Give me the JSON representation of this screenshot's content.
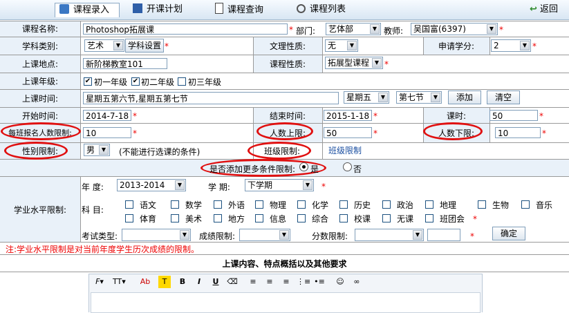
{
  "tabs": [
    {
      "label": "课程录入",
      "icon": "edit-icon",
      "active": true
    },
    {
      "label": "开课计划",
      "icon": "book-icon"
    },
    {
      "label": "课程查询",
      "icon": "document-icon"
    },
    {
      "label": "课程列表",
      "icon": "search-icon"
    }
  ],
  "back_label": "返回",
  "course_name": {
    "label": "课程名称:",
    "value": "Photoshop拓展课"
  },
  "dept": {
    "label": "部门:",
    "value": "艺体部"
  },
  "teacher": {
    "label": "教师:",
    "value": "吴国富(6397)"
  },
  "subject": {
    "label": "学科类别:",
    "value": "艺术",
    "button": "学科设置"
  },
  "science": {
    "label": "文理性质:",
    "value": "无"
  },
  "credits": {
    "label": "申请学分:",
    "value": "2"
  },
  "location": {
    "label": "上课地点:",
    "value": "新阶梯教室101"
  },
  "course_type": {
    "label": "课程性质:",
    "value": "拓展型课程"
  },
  "grades": {
    "label": "上课年级:",
    "items": [
      {
        "label": "初一年级",
        "checked": true
      },
      {
        "label": "初二年级",
        "checked": true
      },
      {
        "label": "初三年级",
        "checked": false
      }
    ]
  },
  "time": {
    "label": "上课时间:",
    "value": "星期五第六节,星期五第七节",
    "day": "星期五",
    "period": "第七节",
    "add": "添加",
    "clear": "清空"
  },
  "start": {
    "label": "开始时间:",
    "value": "2014-7-18"
  },
  "end": {
    "label": "结束时间:",
    "value": "2015-1-18"
  },
  "hours": {
    "label": "课时:",
    "value": "50"
  },
  "class_limit": {
    "label": "每班报名人数限制:",
    "value": "10"
  },
  "max": {
    "label": "人数上限:",
    "value": "50"
  },
  "min": {
    "label": "人数下限:",
    "value": "10"
  },
  "gender": {
    "label": "性别限制:",
    "value": "男",
    "note": "(不能进行选课的条件)"
  },
  "class_restrict": {
    "label": "班级限制:",
    "link": "班级限制"
  },
  "more": {
    "label": "是否添加更多条件限制:",
    "yes": "是",
    "no": "否"
  },
  "academic": {
    "label": "学业水平限制:",
    "year_label": "年 度:",
    "year": "2013-2014",
    "term_label": "学 期:",
    "term": "下学期",
    "subject_label": "科 目:",
    "subjects_row1": [
      "语文",
      "数学",
      "外语",
      "物理",
      "化学",
      "历史",
      "政治",
      "地理",
      "生物",
      "音乐"
    ],
    "subjects_row2": [
      "体育",
      "美术",
      "地方",
      "信息",
      "综合",
      "校课",
      "无课",
      "班团会"
    ],
    "exam_label": "考试类型:",
    "score_label": "成绩限制:",
    "points_label": "分数限制:",
    "confirm": "确定"
  },
  "note": "注:学业水平限制是对当前年度学生历次成绩的限制。",
  "content_title": "上课内容、特点概括以及其他要求",
  "colors": {
    "label_bg": "#e9f1f9",
    "accent": "#e01010",
    "border": "#999999"
  }
}
